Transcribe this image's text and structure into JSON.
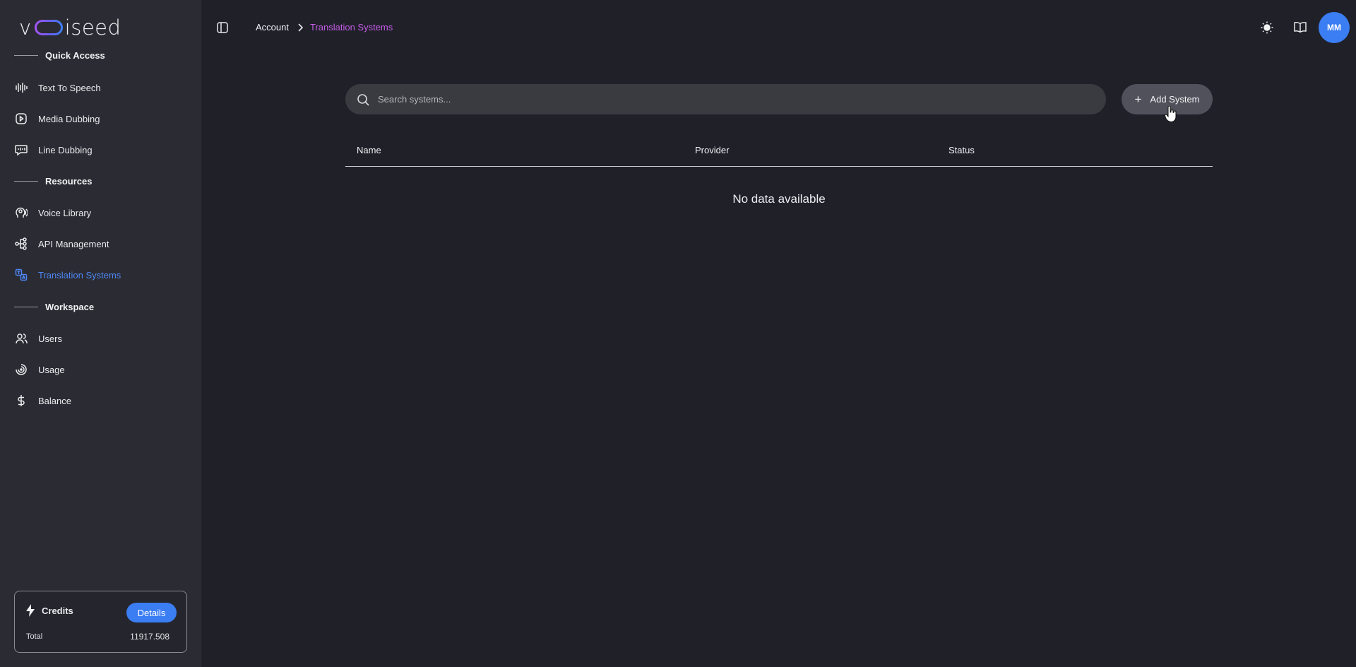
{
  "brand": {
    "logo_left": "v",
    "logo_right": "iseed"
  },
  "sidebar": {
    "sections": [
      {
        "title": "Quick Access"
      },
      {
        "title": "Resources"
      },
      {
        "title": "Workspace"
      }
    ],
    "items": [
      {
        "label": "Text To Speech",
        "icon": "waveform-icon"
      },
      {
        "label": "Media Dubbing",
        "icon": "media-play-icon"
      },
      {
        "label": "Line Dubbing",
        "icon": "speech-bubble-icon"
      },
      {
        "label": "Voice Library",
        "icon": "voice-head-icon"
      },
      {
        "label": "API Management",
        "icon": "api-nodes-icon"
      },
      {
        "label": "Translation Systems",
        "icon": "translate-icon",
        "active": true
      },
      {
        "label": "Users",
        "icon": "users-icon"
      },
      {
        "label": "Usage",
        "icon": "usage-gauge-icon"
      },
      {
        "label": "Balance",
        "icon": "dollar-icon"
      }
    ]
  },
  "credits": {
    "title": "Credits",
    "details_label": "Details",
    "total_label": "Total",
    "total_value": "11917.508"
  },
  "header": {
    "breadcrumb_root": "Account",
    "breadcrumb_current": "Translation Systems",
    "avatar_initials": "MM"
  },
  "main": {
    "search_placeholder": "Search systems...",
    "add_label": "Add System",
    "columns": [
      "Name",
      "Provider",
      "Status"
    ],
    "empty_message": "No data available"
  },
  "colors": {
    "accent": "#3b7df2",
    "active_nav": "#4e86f5",
    "breadcrumb_current": "#c45ce6",
    "background": "#1f2028",
    "sidebar": "#2b2c33"
  }
}
